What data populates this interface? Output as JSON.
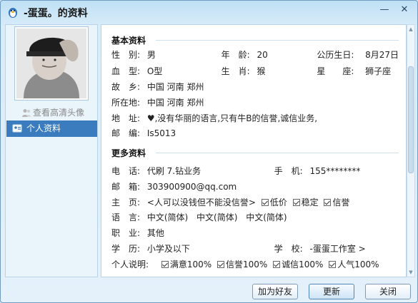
{
  "window": {
    "title": "-蛋蛋。的资料",
    "minimize_glyph": "—",
    "close_glyph": "✕"
  },
  "sidebar": {
    "hd_link": "查看高清头像",
    "nav_item": "个人资料"
  },
  "basic": {
    "section_title": "基本资料",
    "gender_label": "性　别:",
    "gender": "男",
    "age_label": "年　龄:",
    "age": "20",
    "birthday_label": "公历生日:",
    "birthday": "8月27日",
    "blood_label": "血　型:",
    "blood": "O型",
    "zodiac_label": "生　肖:",
    "zodiac": "猴",
    "star_label": "星　　座:",
    "star": "狮子座",
    "hometown_label": "故　乡:",
    "hometown": "中国 河南 郑州",
    "location_label": "所在地:",
    "location": "中国 河南 郑州",
    "address_label": "地　址:",
    "address": "♥,没有华丽的语言,只有牛B的信誉,诚信业务,",
    "postcode_label": "邮　编:",
    "postcode": "Is5013"
  },
  "more": {
    "section_title": "更多资料",
    "phone_label": "电　话:",
    "phone": "代刷 7.钻业务",
    "mobile_label": "手　机:",
    "mobile": "155********",
    "email_label": "邮　箱:",
    "email": "303900900@qq.com",
    "homepage_label": "主　页:",
    "homepage": "<人可以没钱但不能没信誉>",
    "homepage_checks": [
      "低价",
      "稳定",
      "信誉"
    ],
    "language_label": "语　言:",
    "languages": [
      "中文(简体)",
      "中文(简体)",
      "中文(简体)"
    ],
    "job_label": "职　业:",
    "job": "其他",
    "education_label": "学　历:",
    "education": "小学及以下",
    "school_label": "学　校:",
    "school": "-蛋蛋工作室 >",
    "intro_label": "个人说明:",
    "intro_checks": [
      "满意100%",
      "信誉100%",
      "诚信100%",
      "人气100%"
    ]
  },
  "buttons": {
    "add_friend": "加为好友",
    "refresh": "更新",
    "close": "关闭"
  }
}
